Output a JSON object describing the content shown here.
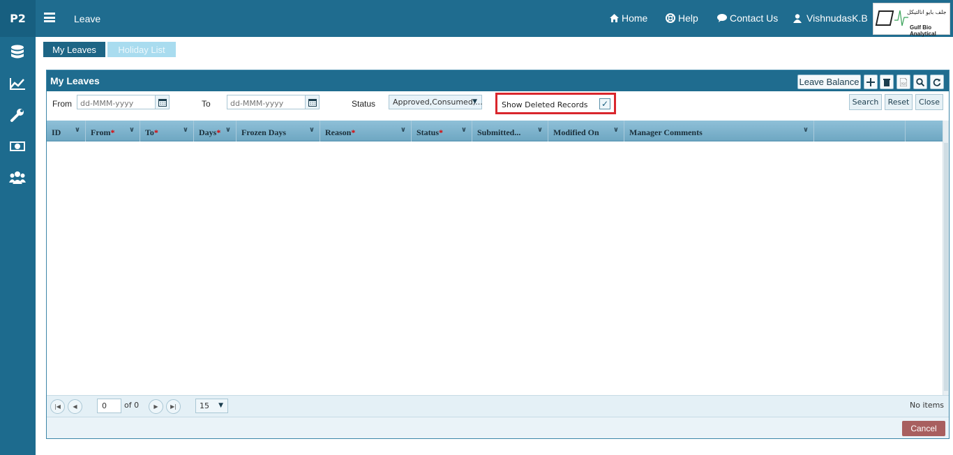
{
  "sidebar": {
    "brand": "P2",
    "icons": [
      "database-icon",
      "chart-line-icon",
      "wrench-icon",
      "money-icon",
      "users-icon"
    ]
  },
  "topbar": {
    "title": "Leave",
    "nav": {
      "home": "Home",
      "help": "Help",
      "contact": "Contact Us",
      "user": "VishnudasK.B"
    },
    "logo": {
      "arabic": "جلف بايو انالتيكل",
      "english": "Gulf Bio Analytical"
    }
  },
  "tabs": {
    "my_leaves": "My Leaves",
    "holiday_list": "Holiday List"
  },
  "panel": {
    "title": "My Leaves",
    "leave_balance": "Leave Balance"
  },
  "filters": {
    "from_label": "From",
    "to_label": "To",
    "status_label": "Status",
    "date_placeholder": "dd-MMM-yyyy",
    "status_value": "Approved,Consumed,...",
    "show_deleted_label": "Show Deleted Records",
    "show_deleted_checked": true,
    "checkmark": "✓",
    "search": "Search",
    "reset": "Reset",
    "close": "Close"
  },
  "grid": {
    "columns": [
      {
        "label": "ID",
        "required": ""
      },
      {
        "label": "From",
        "required": "*"
      },
      {
        "label": "To",
        "required": "*"
      },
      {
        "label": "Days",
        "required": "*"
      },
      {
        "label": "Frozen Days",
        "required": ""
      },
      {
        "label": "Reason",
        "required": "*"
      },
      {
        "label": "Status",
        "required": "*"
      },
      {
        "label": "Submitted...",
        "required": ""
      },
      {
        "label": "Modified On",
        "required": ""
      },
      {
        "label": "Manager Comments",
        "required": ""
      }
    ]
  },
  "pager": {
    "page": "0",
    "of_text": "of 0",
    "page_size": "15",
    "items_text": "No items"
  },
  "footer": {
    "cancel": "Cancel"
  },
  "colors": {
    "primary": "#1f6c8f",
    "highlight_border": "#d9262c",
    "cancel": "#a85f5f"
  }
}
